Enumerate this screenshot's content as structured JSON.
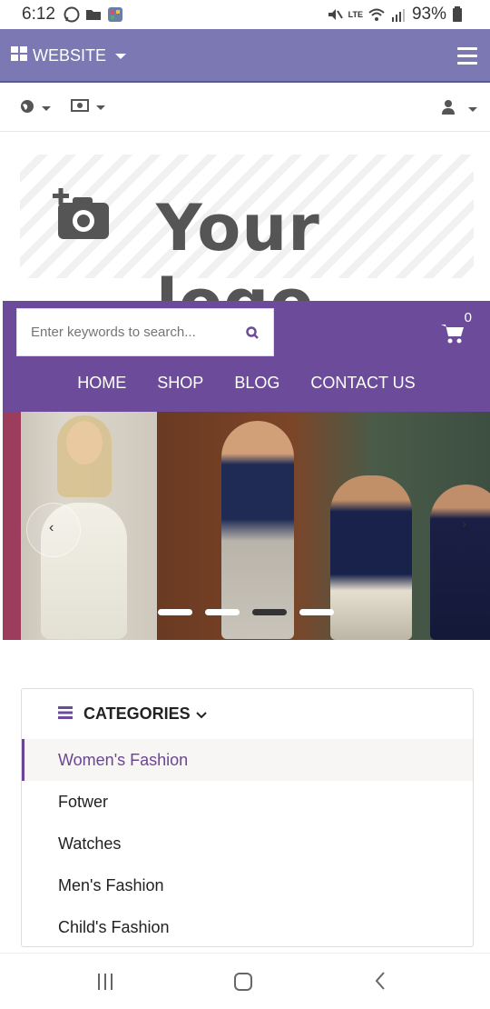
{
  "status_bar": {
    "time": "6:12",
    "battery": "93%",
    "network": "LTE"
  },
  "topbar": {
    "website_label": "WEBSITE"
  },
  "logo": {
    "text": "Your logo"
  },
  "search": {
    "placeholder": "Enter keywords to search..."
  },
  "cart": {
    "count": "0"
  },
  "nav": {
    "items": [
      "HOME",
      "SHOP",
      "BLOG",
      "CONTACT US"
    ]
  },
  "slider": {
    "dot_count": 4,
    "active_dot": 3
  },
  "categories": {
    "title": "CATEGORIES",
    "items": [
      "Women's Fashion",
      "Fotwer",
      "Watches",
      "Men's Fashion",
      "Child's Fashion"
    ],
    "active_item": "Women's Fashion"
  },
  "colors": {
    "topbar": "#7b78b4",
    "brand_purple": "#6c4c9a",
    "active_category": "#6b4593"
  }
}
